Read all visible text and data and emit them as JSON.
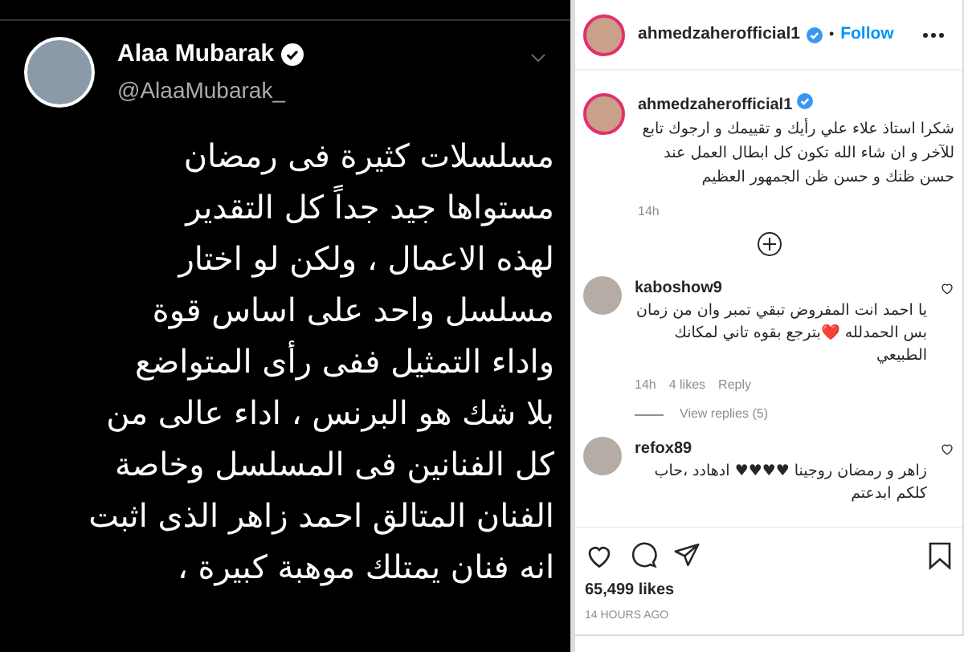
{
  "tweet": {
    "name": "Alaa Mubarak",
    "verified": true,
    "handle": "@AlaaMubarak_",
    "lines": [
      "مسلسلات كثيرة فى رمضان",
      "مستواها جيد جداً كل التقدير",
      "لهذه الاعمال ، ولكن لو اختار",
      "مسلسل واحد على اساس قوة",
      "واداء التمثيل ففى رأى المتواضع",
      "بلا شك هو البرنس ، اداء عالى من",
      "كل الفنانين فى المسلسل وخاصة",
      "الفنان المتالق احمد زاهر الذى اثبت",
      "انه فنان يمتلك موهبة كبيرة ،"
    ]
  },
  "header": {
    "username": "ahmedzaherofficial1",
    "verified": true,
    "separator": "•",
    "follow": "Follow"
  },
  "caption": {
    "username": "ahmedzaherofficial1",
    "verified": true,
    "text": "شكرا استاذ علاء علي رأيك و تقييمك و ارجوك تابع للآخر و ان شاء الله تكون كل ابطال العمل عند حسن ظنك و حسن ظن الجمهور العظيم",
    "time": "14h"
  },
  "comments": [
    {
      "username": "kaboshow9",
      "text": "يا احمد انت المفروض تبقي تمبر وان من زمان بس الحمدلله ❤️بترجع بقوه تاني لمكانك الطبيعي",
      "time": "14h",
      "likes": "4 likes",
      "reply": "Reply",
      "view_replies": "View replies (5)",
      "liked": false
    },
    {
      "username": "refox89",
      "text": "زاهر و رمضان روجينا ♥♥♥♥ ادهادد ،حاب كلكم ابدعتم",
      "liked": false
    }
  ],
  "likes": "65,499 likes",
  "posted": "14 HOURS AGO",
  "saved": false
}
